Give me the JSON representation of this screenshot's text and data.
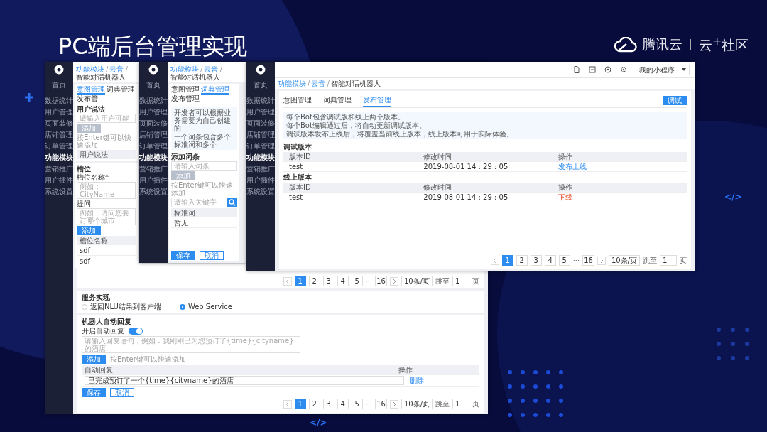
{
  "slide": {
    "title": "PC端后台管理实现",
    "brand": "腾讯云",
    "community": "云$^{+}$社区",
    "code_marks": [
      "</>",
      "</>"
    ]
  },
  "w1": {
    "sidebar": {
      "home": "首页",
      "items": [
        {
          "label": "数据统计",
          "selected": false
        },
        {
          "label": "用户管理",
          "selected": false
        },
        {
          "label": "页面装修",
          "selected": false
        },
        {
          "label": "店铺管理",
          "selected": false
        },
        {
          "label": "订单管理",
          "selected": false
        },
        {
          "label": "功能模块",
          "selected": true
        },
        {
          "label": "营销推广",
          "selected": false
        },
        {
          "label": "用户插件",
          "selected": false
        },
        {
          "label": "系统设置",
          "selected": false
        }
      ]
    },
    "breadcrumb": [
      "功能模块",
      "云音",
      "智能对话机器人"
    ],
    "crumb_sep": "/",
    "tabs": [
      {
        "label": "意图管理",
        "selected": true
      },
      {
        "label": "词典管理",
        "selected": false
      },
      {
        "label": "发布管",
        "selected": false
      }
    ],
    "utterance": {
      "label": "用户说法",
      "placeholder": "请输入用户可能",
      "add": "添加",
      "add_disabled": true,
      "hint": "按Enter键可以快速添加",
      "column": "用户说法"
    },
    "slots": {
      "label": "槽位",
      "name_label": "槽位名称*",
      "name_placeholder": "例如：CityName",
      "ask_label": "提问",
      "ask_placeholder": "例如：请问您要订哪个城市",
      "add": "添加",
      "column": "槽位名称",
      "rows": [
        "sdf",
        "sdf"
      ]
    },
    "pagination": {
      "pages": [
        {
          "label": "1",
          "selected": true
        },
        {
          "label": "2",
          "selected": false
        },
        {
          "label": "3",
          "selected": false
        },
        {
          "label": "4",
          "selected": false
        },
        {
          "label": "5",
          "selected": false
        }
      ],
      "ellipsis": "···",
      "last": "16",
      "size": "10条/页",
      "jump": "跳至",
      "page": "1",
      "unit": "页"
    },
    "service": {
      "label": "服务实现",
      "options": [
        {
          "label": "返回NLU结果到客户端",
          "selected": false
        },
        {
          "label": "Web Service",
          "selected": true
        }
      ]
    },
    "auto_reply": {
      "label": "机器人自动回复",
      "toggle_label": "开启自动回复",
      "on": true,
      "placeholder": "请输入回复语句，例如：我刚刚已为您预订了{time}{cityname}的酒店",
      "add": "添加",
      "add_disabled": false,
      "hint": "按Enter键可以快速添加",
      "columns": [
        "自动回复",
        "操作"
      ],
      "rows": [
        {
          "text": "已完成预订了一个{time}{cityname}的酒店",
          "action": "删除"
        }
      ],
      "save": "保存",
      "cancel": "取消"
    },
    "pagination2": {
      "pages": [
        {
          "label": "1",
          "selected": true
        },
        {
          "label": "2",
          "selected": false
        },
        {
          "label": "3",
          "selected": false
        },
        {
          "label": "4",
          "selected": false
        },
        {
          "label": "5",
          "selected": false
        }
      ],
      "ellipsis": "···",
      "last": "16",
      "size": "10条/页",
      "jump": "跳至",
      "page": "1",
      "unit": "页"
    }
  },
  "w2": {
    "sidebar": {
      "home": "首页",
      "items": [
        {
          "label": "数据统计",
          "selected": false
        },
        {
          "label": "用户管理",
          "selected": false
        },
        {
          "label": "页面装修",
          "selected": false
        },
        {
          "label": "店铺管理",
          "selected": false
        },
        {
          "label": "订单管理",
          "selected": false
        },
        {
          "label": "功能模块",
          "selected": true
        },
        {
          "label": "营销推广",
          "selected": false
        },
        {
          "label": "用户插件",
          "selected": false
        },
        {
          "label": "系统设置",
          "selected": false
        }
      ]
    },
    "breadcrumb": [
      "功能模块",
      "云音",
      "智能对话机器人"
    ],
    "crumb_sep": "/",
    "tabs": [
      {
        "label": "意图管理",
        "selected": false
      },
      {
        "label": "词典管理",
        "selected": true
      },
      {
        "label": "发布管理",
        "selected": false
      }
    ],
    "notices": [
      "开发者可以根据业务需要为自己创建的",
      "一个词条包含多个标准词和多个"
    ],
    "entry": {
      "label": "添加词条",
      "placeholder": "请输入词条",
      "add": "添加",
      "add_disabled": true,
      "hint": "按Enter键可以快速添加"
    },
    "search": {
      "placeholder": "请输入关键字"
    },
    "table": {
      "column": "标准词",
      "empty": "暂无"
    },
    "save": "保存",
    "cancel": "取消"
  },
  "w3": {
    "sidebar": {
      "home": "首页",
      "items": [
        {
          "label": "数据统计",
          "selected": false
        },
        {
          "label": "用户管理",
          "selected": false
        },
        {
          "label": "页面装修",
          "selected": false
        },
        {
          "label": "店铺管理",
          "selected": false
        },
        {
          "label": "订单管理",
          "selected": false
        },
        {
          "label": "功能模块",
          "selected": true
        },
        {
          "label": "营销推广",
          "selected": false
        },
        {
          "label": "用户插件",
          "selected": false
        },
        {
          "label": "系统设置",
          "selected": false
        }
      ]
    },
    "app_select": "我的小程序",
    "breadcrumb": [
      "功能模块",
      "云音",
      "智能对话机器人"
    ],
    "crumb_sep": "/",
    "tabs": [
      {
        "label": "意图管理",
        "selected": false
      },
      {
        "label": "词典管理",
        "selected": false
      },
      {
        "label": "发布管理",
        "selected": true
      }
    ],
    "debug_button": "调试",
    "notices": [
      "每个Bot包含调试版和线上两个版本。",
      "每个Bot编辑通过后，将自动更新调试版本。",
      "调试版本发布上线后，将覆盖当前线上版本，线上版本可用于实际体验。"
    ],
    "sections": [
      {
        "title": "调试版本",
        "columns": [
          "版本ID",
          "修改时间",
          "操作"
        ],
        "rows": [
          {
            "id": "test",
            "time": "2019-08-01  14 : 29 : 05",
            "action": "发布上线",
            "kind": "publish"
          }
        ]
      },
      {
        "title": "线上版本",
        "columns": [
          "版本ID",
          "修改时间",
          "操作"
        ],
        "rows": [
          {
            "id": "test",
            "time": "2019-08-01  14 : 29 : 05",
            "action": "下线",
            "kind": "offline"
          }
        ]
      }
    ],
    "pagination": {
      "pages": [
        {
          "label": "1",
          "selected": true
        },
        {
          "label": "2",
          "selected": false
        },
        {
          "label": "3",
          "selected": false
        },
        {
          "label": "4",
          "selected": false
        },
        {
          "label": "5",
          "selected": false
        }
      ],
      "ellipsis": "···",
      "last": "16",
      "size": "10条/页",
      "jump": "跳至",
      "page": "1",
      "unit": "页"
    }
  }
}
